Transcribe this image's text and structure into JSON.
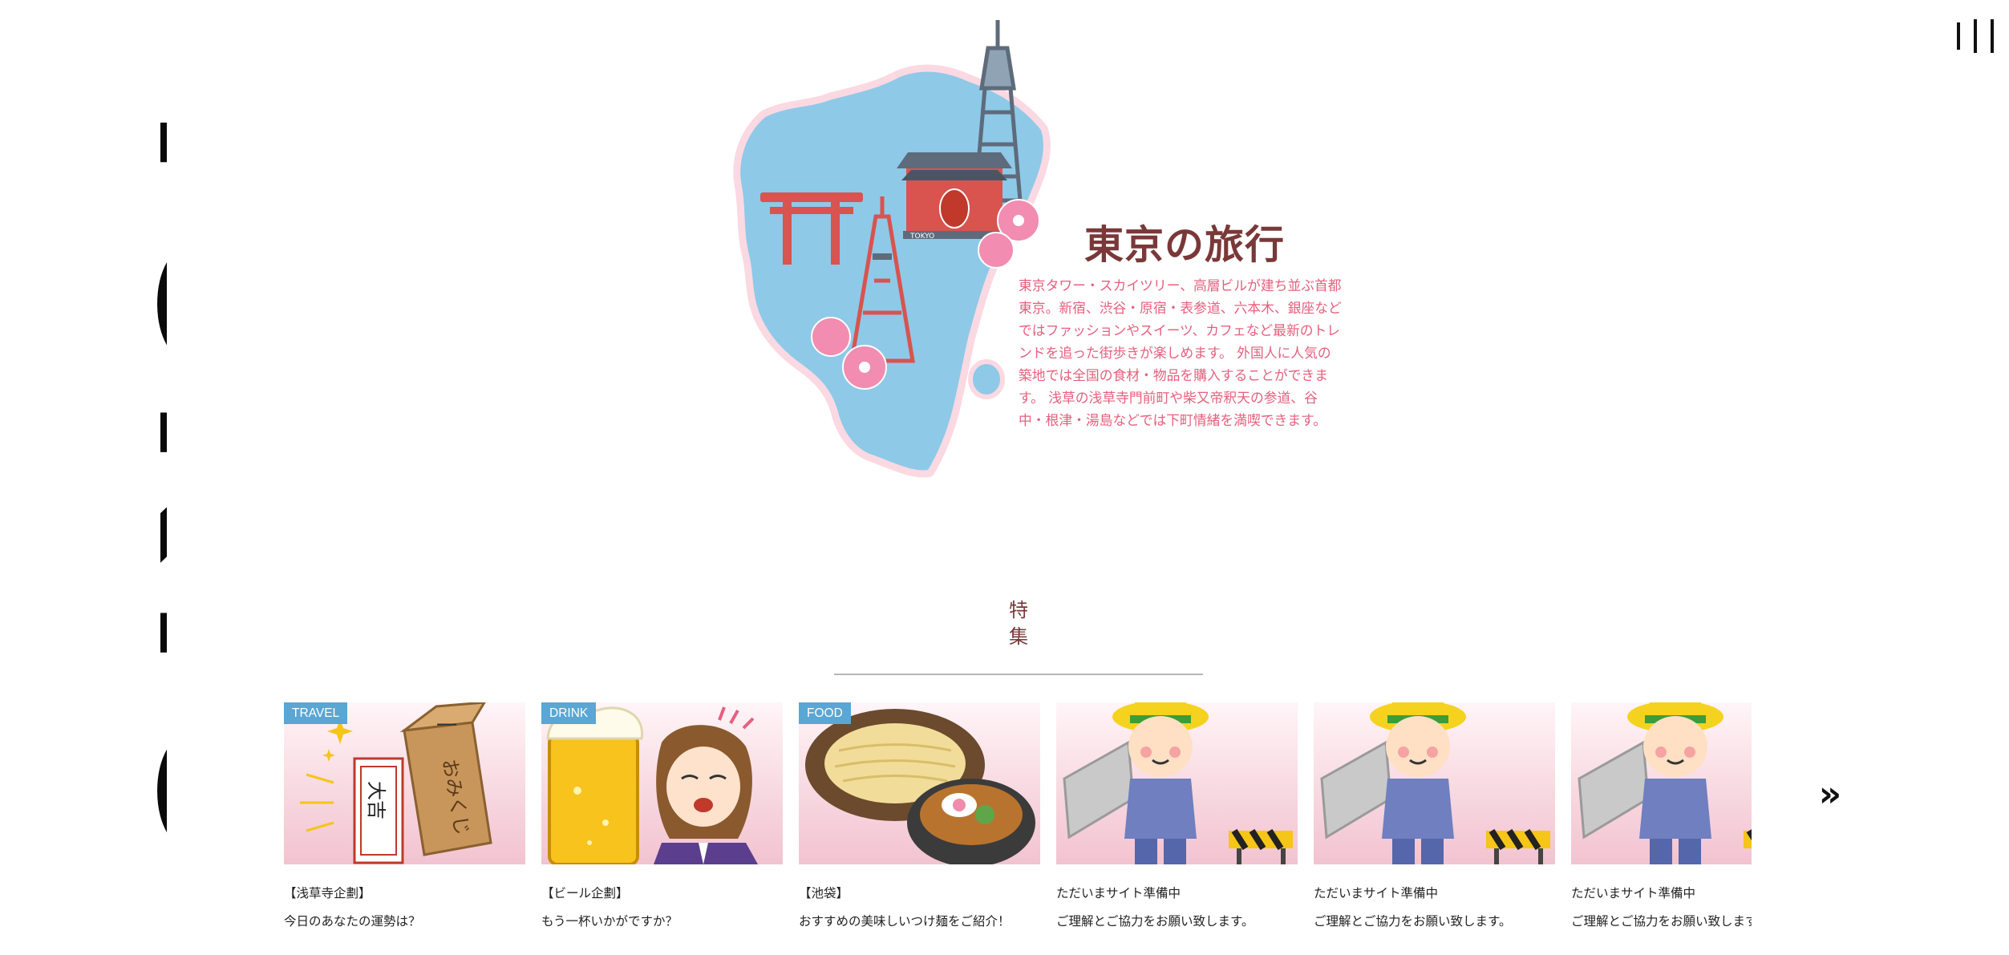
{
  "brand": {
    "vertical_title": "TOKYO"
  },
  "header": {
    "menu_icon": "hamburger-vertical-icon"
  },
  "hero": {
    "title": "東京の旅行",
    "description": "東京タワー・スカイツリー、高層ビルが建ち並ぶ首都東京。新宿、渋谷・原宿・表参道、六本木、銀座などではファッションやスイーツ、カフェなど最新のトレンドを追った街歩きが楽しめます。 外国人に人気の築地では全国の食材・物品を購入することができます。 浅草の浅草寺門前町や柴又帝釈天の参道、谷中・根津・湯島などでは下町情緒を満喫できます。",
    "illustration_sign": "TOKYO"
  },
  "features": {
    "heading_line1": "特",
    "heading_line2": "集",
    "next_icon": "double-chevron-right-icon",
    "cards": [
      {
        "tag": "TRAVEL",
        "line1": "【浅草寺企劃】",
        "line2": "今日のあなたの運勢は？",
        "omikuji_label": "おみくじ",
        "daikichi": "大吉",
        "box_mark": "一"
      },
      {
        "tag": "DRINK",
        "line1": "【ビール企劃】",
        "line2": "もう一杯いかがですか？"
      },
      {
        "tag": "FOOD",
        "line1": "【池袋】",
        "line2": "おすすめの美味しいつけ麺をご紹介！"
      },
      {
        "tag": "",
        "line1": "ただいまサイト準備中",
        "line2": "ご理解とご協力をお願い致します。"
      },
      {
        "tag": "",
        "line1": "ただいまサイト準備中",
        "line2": "ご理解とご協力をお願い致します。"
      },
      {
        "tag": "",
        "line1": "ただいまサイト準備中",
        "line2": "ご理解とご協力をお願い致します。"
      }
    ]
  },
  "colors": {
    "accent_title": "#7a3838",
    "accent_text": "#e5607e",
    "tag_blue": "#5aa6d4",
    "map_blue": "#8ec9e8"
  }
}
